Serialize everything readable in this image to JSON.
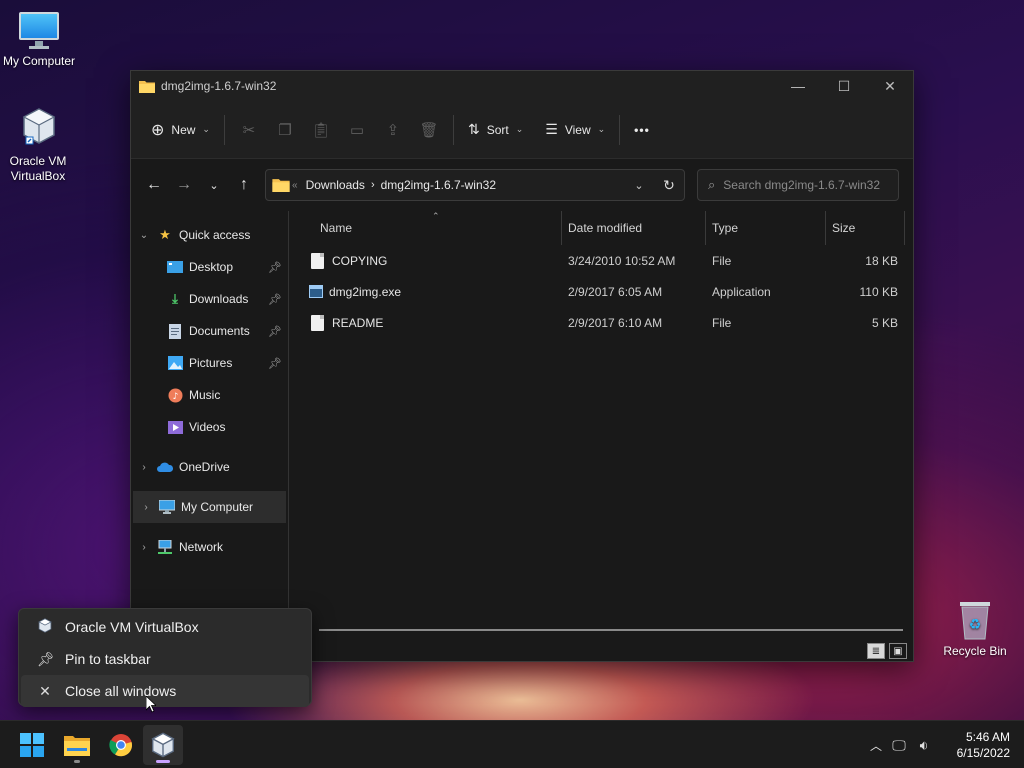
{
  "desktop": {
    "icons": [
      {
        "label": "My Computer",
        "icon": "monitor-icon"
      },
      {
        "label": "Oracle VM VirtualBox",
        "icon": "virtualbox-icon"
      },
      {
        "label": "Recycle Bin",
        "icon": "recycle-bin-icon"
      }
    ]
  },
  "window": {
    "title": "dmg2img-1.6.7-win32",
    "controls": {
      "minimize": "—",
      "maximize": "☐",
      "close": "✕"
    },
    "toolbar": {
      "new_label": "New",
      "sort_label": "Sort",
      "view_label": "View",
      "more_label": "•••",
      "disabled_actions": [
        "cut-icon",
        "copy-icon",
        "paste-icon",
        "rename-icon",
        "share-icon",
        "delete-icon"
      ]
    },
    "address": {
      "crumbs": [
        "Downloads",
        "dmg2img-1.6.7-win32"
      ],
      "search_placeholder": "Search dmg2img-1.6.7-win32"
    },
    "nav": {
      "quick_access": "Quick access",
      "quick_items": [
        {
          "label": "Desktop",
          "pinned": true
        },
        {
          "label": "Downloads",
          "pinned": true
        },
        {
          "label": "Documents",
          "pinned": true
        },
        {
          "label": "Pictures",
          "pinned": true
        },
        {
          "label": "Music",
          "pinned": false
        },
        {
          "label": "Videos",
          "pinned": false
        }
      ],
      "roots": [
        {
          "label": "OneDrive"
        },
        {
          "label": "My Computer",
          "selected": true
        },
        {
          "label": "Network"
        }
      ]
    },
    "columns": [
      "Name",
      "Date modified",
      "Type",
      "Size"
    ],
    "files": [
      {
        "name": "COPYING",
        "date": "3/24/2010 10:52 AM",
        "type": "File",
        "size": "18 KB",
        "icon": "file-icon"
      },
      {
        "name": "dmg2img.exe",
        "date": "2/9/2017 6:05 AM",
        "type": "Application",
        "size": "110 KB",
        "icon": "exe-icon"
      },
      {
        "name": "README",
        "date": "2/9/2017 6:10 AM",
        "type": "File",
        "size": "5 KB",
        "icon": "file-icon"
      }
    ]
  },
  "jumplist": {
    "items": [
      {
        "label": "Oracle VM VirtualBox",
        "icon": "virtualbox-icon"
      },
      {
        "label": "Pin to taskbar",
        "icon": "pin-icon"
      },
      {
        "label": "Close all windows",
        "icon": "close-icon"
      }
    ]
  },
  "taskbar": {
    "apps": [
      "start-icon",
      "file-explorer-icon",
      "chrome-icon",
      "virtualbox-icon"
    ],
    "clock": {
      "time": "5:46 AM",
      "date": "6/15/2022"
    }
  },
  "colors": {
    "accent": "#c9a2ff",
    "window_bg": "#191919",
    "folder": "#f4c04f"
  }
}
